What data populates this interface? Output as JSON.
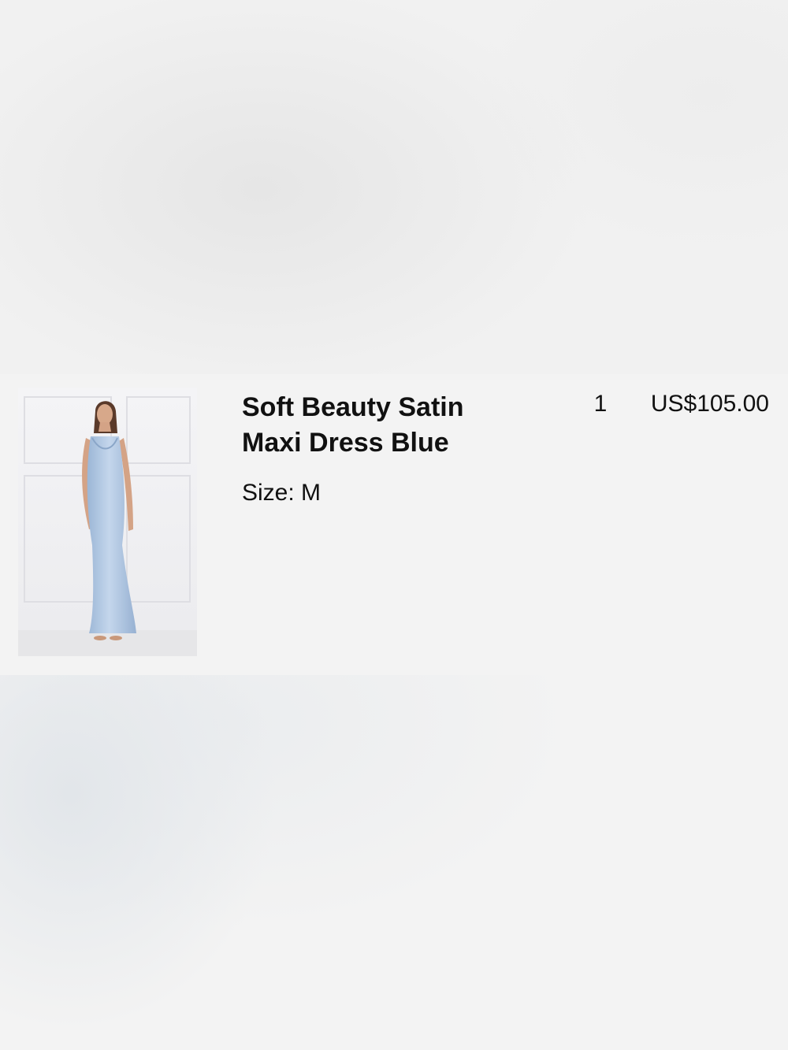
{
  "order_item": {
    "name": "Soft Beauty Satin Maxi Dress Blue",
    "size_label": "Size:",
    "size_value": "M",
    "quantity": "1",
    "price": "US$105.00"
  },
  "colors": {
    "background": "#f2f2f2",
    "dress_blue": "#a9c3e0",
    "text": "#111111"
  }
}
